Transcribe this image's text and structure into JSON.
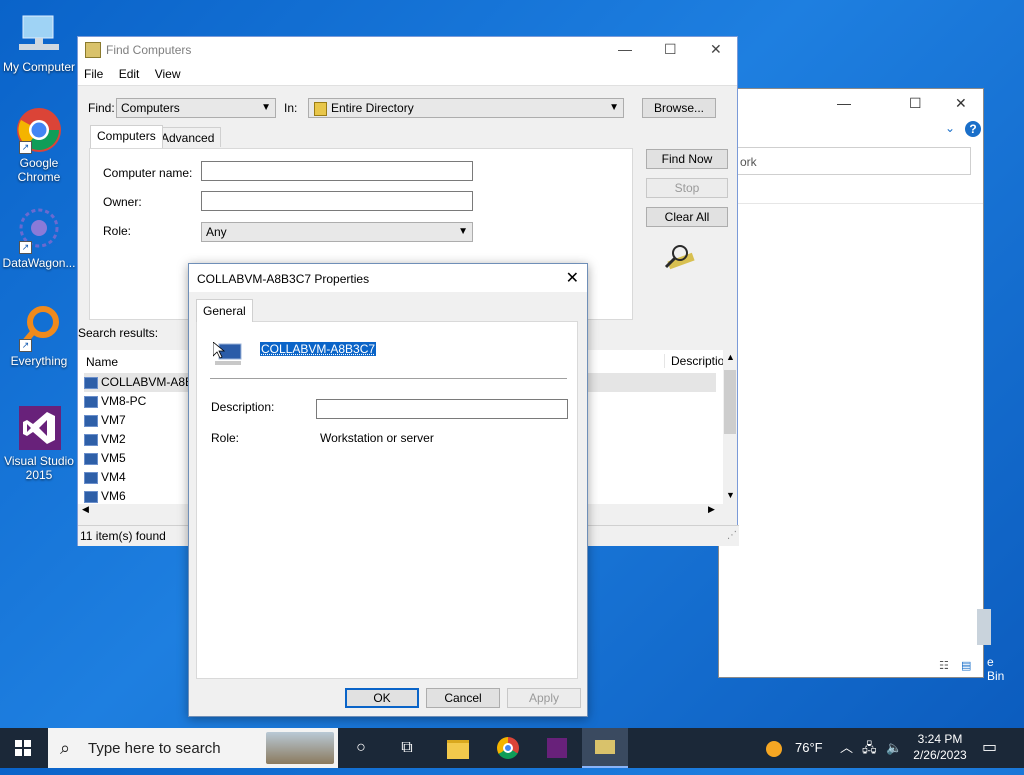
{
  "desktop": {
    "icons": [
      {
        "label": "My Computer"
      },
      {
        "label": "Google Chrome"
      },
      {
        "label": "DataWagon..."
      },
      {
        "label": "Everything"
      },
      {
        "label": "Visual Studio 2015"
      }
    ],
    "recycle_bin_label": "e Bin"
  },
  "bg_window": {
    "address_text": "ork"
  },
  "find_window": {
    "title": "Find Computers",
    "menu": [
      "File",
      "Edit",
      "View"
    ],
    "find_label": "Find:",
    "find_value": "Computers",
    "in_label": "In:",
    "in_value": "Entire Directory",
    "browse_label": "Browse...",
    "tabs": [
      "Computers",
      "Advanced"
    ],
    "computer_name_label": "Computer name:",
    "computer_name_value": "",
    "owner_label": "Owner:",
    "owner_value": "",
    "role_label": "Role:",
    "role_value": "Any",
    "find_now_label": "Find Now",
    "stop_label": "Stop",
    "clear_all_label": "Clear All",
    "search_results_label": "Search results:",
    "columns": [
      "Name",
      "Descriptio"
    ],
    "results": [
      "COLLABVM-A8B",
      "VM8-PC",
      "VM7",
      "VM2",
      "VM5",
      "VM4",
      "VM6"
    ],
    "status": "11 item(s) found"
  },
  "properties": {
    "title": "COLLABVM-A8B3C7 Properties",
    "tab": "General",
    "name": "COLLABVM-A8B3C7",
    "description_label": "Description:",
    "description_value": "",
    "role_label": "Role:",
    "role_value": "Workstation or server",
    "ok_label": "OK",
    "cancel_label": "Cancel",
    "apply_label": "Apply"
  },
  "taskbar": {
    "search_placeholder": "Type here to search",
    "weather": "76°F",
    "time": "3:24 PM",
    "date": "2/26/2023"
  },
  "colors": {
    "desktop": "#1e7fe0",
    "selection": "#0a64c8",
    "taskbar": "#1b2838"
  }
}
